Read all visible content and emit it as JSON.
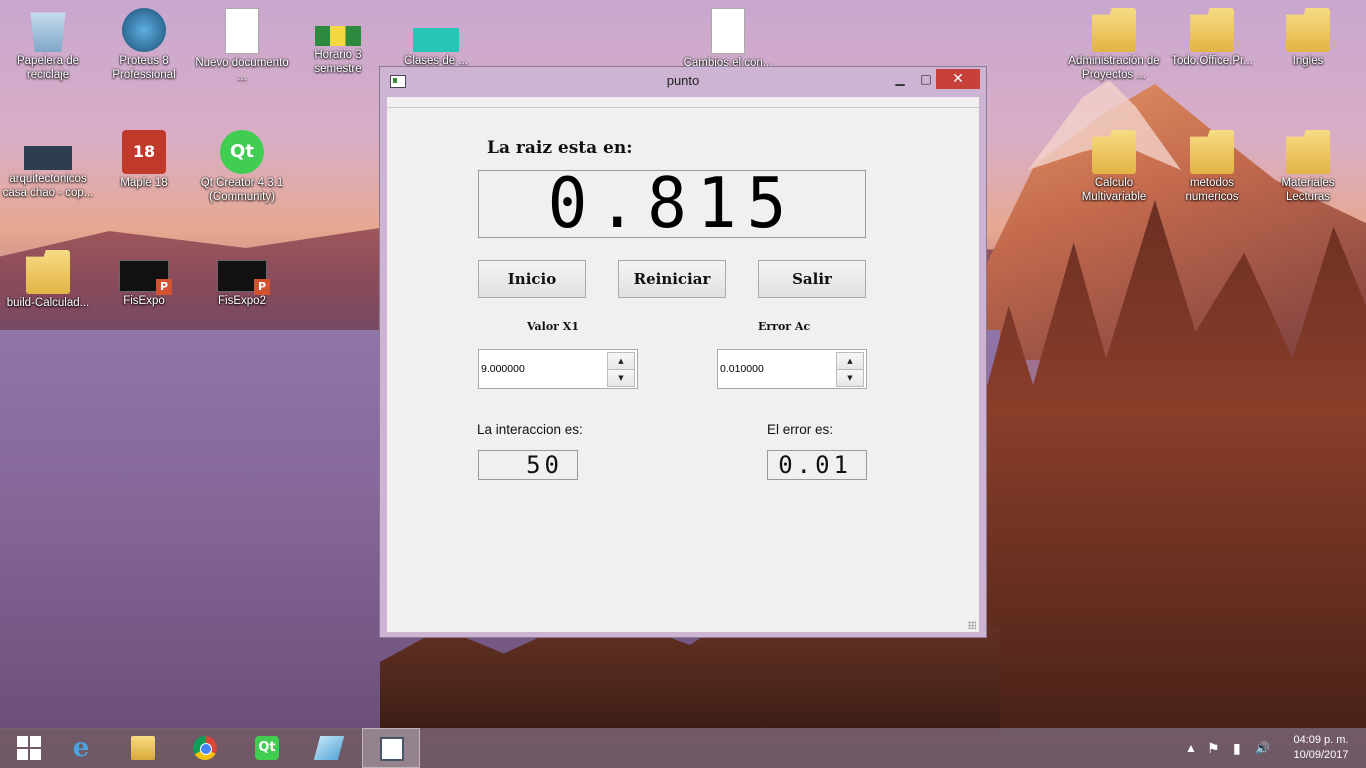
{
  "desktop": {
    "icons": [
      {
        "label": "Papelera de reciclaje",
        "icon": "recycle-bin-icon"
      },
      {
        "label": "Proteus 8 Professional",
        "icon": "proteus-icon"
      },
      {
        "label": "Nuevo documento ...",
        "icon": "document-icon"
      },
      {
        "label": "Horario 3 semestre",
        "icon": "excel-file-icon"
      },
      {
        "label": "Clases de ...",
        "icon": "powerpoint-file-icon"
      },
      {
        "label": "Cambios el con...",
        "icon": "document-icon"
      },
      {
        "label": "Administración de Proyectos ...",
        "icon": "folder-icon"
      },
      {
        "label": "Todo.Office.Pr...",
        "icon": "folder-icon"
      },
      {
        "label": "Ingles",
        "icon": "folder-icon"
      },
      {
        "label": "arquitectonicos casa chao - cop...",
        "icon": "autocad-file-icon"
      },
      {
        "label": "Maple 18",
        "icon": "maple-icon"
      },
      {
        "label": "Qt Creator 4.3.1 (Community)",
        "icon": "qt-creator-icon"
      },
      {
        "label": "Calculo Multivariable",
        "icon": "folder-icon"
      },
      {
        "label": "metodos numericos",
        "icon": "folder-icon"
      },
      {
        "label": "Materiales Lecturas",
        "icon": "folder-icon"
      },
      {
        "label": "build-Calculad...",
        "icon": "folder-icon"
      },
      {
        "label": "FisExpo",
        "icon": "powerpoint-file-icon"
      },
      {
        "label": "FisExpo2",
        "icon": "powerpoint-file-icon"
      }
    ]
  },
  "window": {
    "title": "punto",
    "minimize_glyph": "▁",
    "maximize_glyph": "□",
    "close_glyph": "✕"
  },
  "app": {
    "root_label": "La raiz esta en:",
    "root_value": "0.815",
    "buttons": {
      "start": "Inicio",
      "reset": "Reiniciar",
      "exit": "Salir"
    },
    "x1_label": "Valor X1",
    "x1_value": "9.000000",
    "error_label": "Error Ac",
    "error_value": "0.010000",
    "spin_up": "▲",
    "spin_down": "▼",
    "iteration_label": "La interaccion es:",
    "iteration_value": "50",
    "error_result_label": "El error es:",
    "error_result_value": "0.01"
  },
  "taskbar": {
    "apps": [
      "start",
      "internet-explorer",
      "file-explorer",
      "chrome",
      "qt-creator",
      "crystal-app",
      "punto"
    ],
    "tray": {
      "up_arrow": "▲",
      "flag": "⚑",
      "battery": "▮",
      "volume": "🔊"
    },
    "time": "04:09 p. m.",
    "date": "10/09/2017"
  }
}
